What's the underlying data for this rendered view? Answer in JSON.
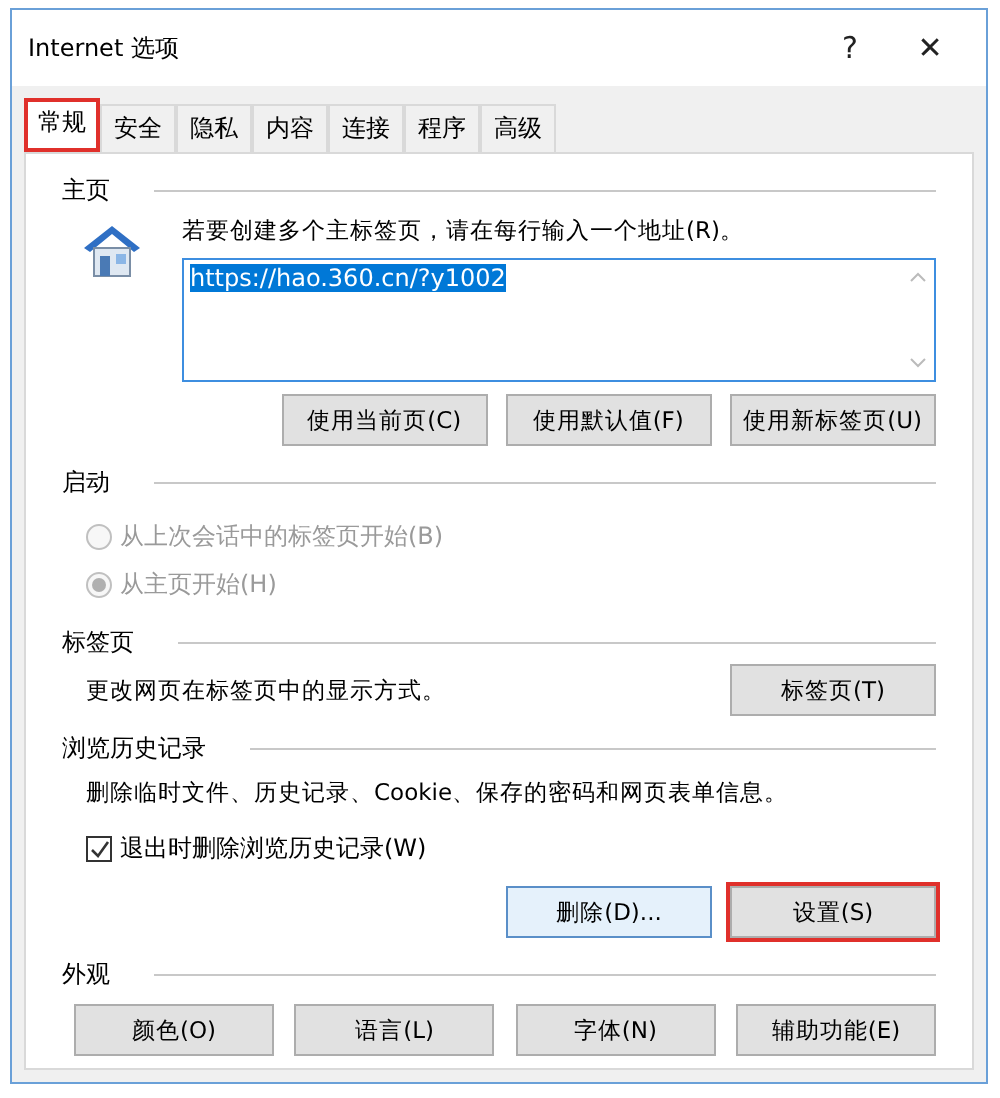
{
  "window": {
    "title": "Internet 选项",
    "help": "?",
    "close": "✕"
  },
  "tabs": [
    {
      "label": "常规",
      "selected": true,
      "highlighted": true
    },
    {
      "label": "安全",
      "selected": false,
      "highlighted": false
    },
    {
      "label": "隐私",
      "selected": false,
      "highlighted": false
    },
    {
      "label": "内容",
      "selected": false,
      "highlighted": false
    },
    {
      "label": "连接",
      "selected": false,
      "highlighted": false
    },
    {
      "label": "程序",
      "selected": false,
      "highlighted": false
    },
    {
      "label": "高级",
      "selected": false,
      "highlighted": false
    }
  ],
  "home": {
    "heading": "主页",
    "hint": "若要创建多个主标签页，请在每行输入一个地址(R)。",
    "value": "https://hao.360.cn/?y1002",
    "buttons": [
      {
        "label": "使用当前页(C)",
        "highlighted": false,
        "focused": false
      },
      {
        "label": "使用默认值(F)",
        "highlighted": false,
        "focused": false
      },
      {
        "label": "使用新标签页(U)",
        "highlighted": false,
        "focused": false
      }
    ]
  },
  "startup": {
    "heading": "启动",
    "options": [
      {
        "label": "从上次会话中的标签页开始(B)",
        "selected": false,
        "disabled": true
      },
      {
        "label": "从主页开始(H)",
        "selected": true,
        "disabled": true
      }
    ]
  },
  "tabs_section": {
    "heading": "标签页",
    "text": "更改网页在标签页中的显示方式。",
    "button": {
      "label": "标签页(T)",
      "highlighted": false,
      "focused": false
    }
  },
  "history": {
    "heading": "浏览历史记录",
    "text": "删除临时文件、历史记录、Cookie、保存的密码和网页表单信息。",
    "checkbox": {
      "label": "退出时删除浏览历史记录(W)",
      "checked": true
    },
    "buttons": [
      {
        "label": "删除(D)...",
        "highlighted": false,
        "focused": true
      },
      {
        "label": "设置(S)",
        "highlighted": true,
        "focused": false
      }
    ]
  },
  "appearance": {
    "heading": "外观",
    "buttons": [
      {
        "label": "颜色(O)",
        "highlighted": false,
        "focused": false
      },
      {
        "label": "语言(L)",
        "highlighted": false,
        "focused": false
      },
      {
        "label": "字体(N)",
        "highlighted": false,
        "focused": false
      },
      {
        "label": "辅助功能(E)",
        "highlighted": false,
        "focused": false
      }
    ]
  }
}
